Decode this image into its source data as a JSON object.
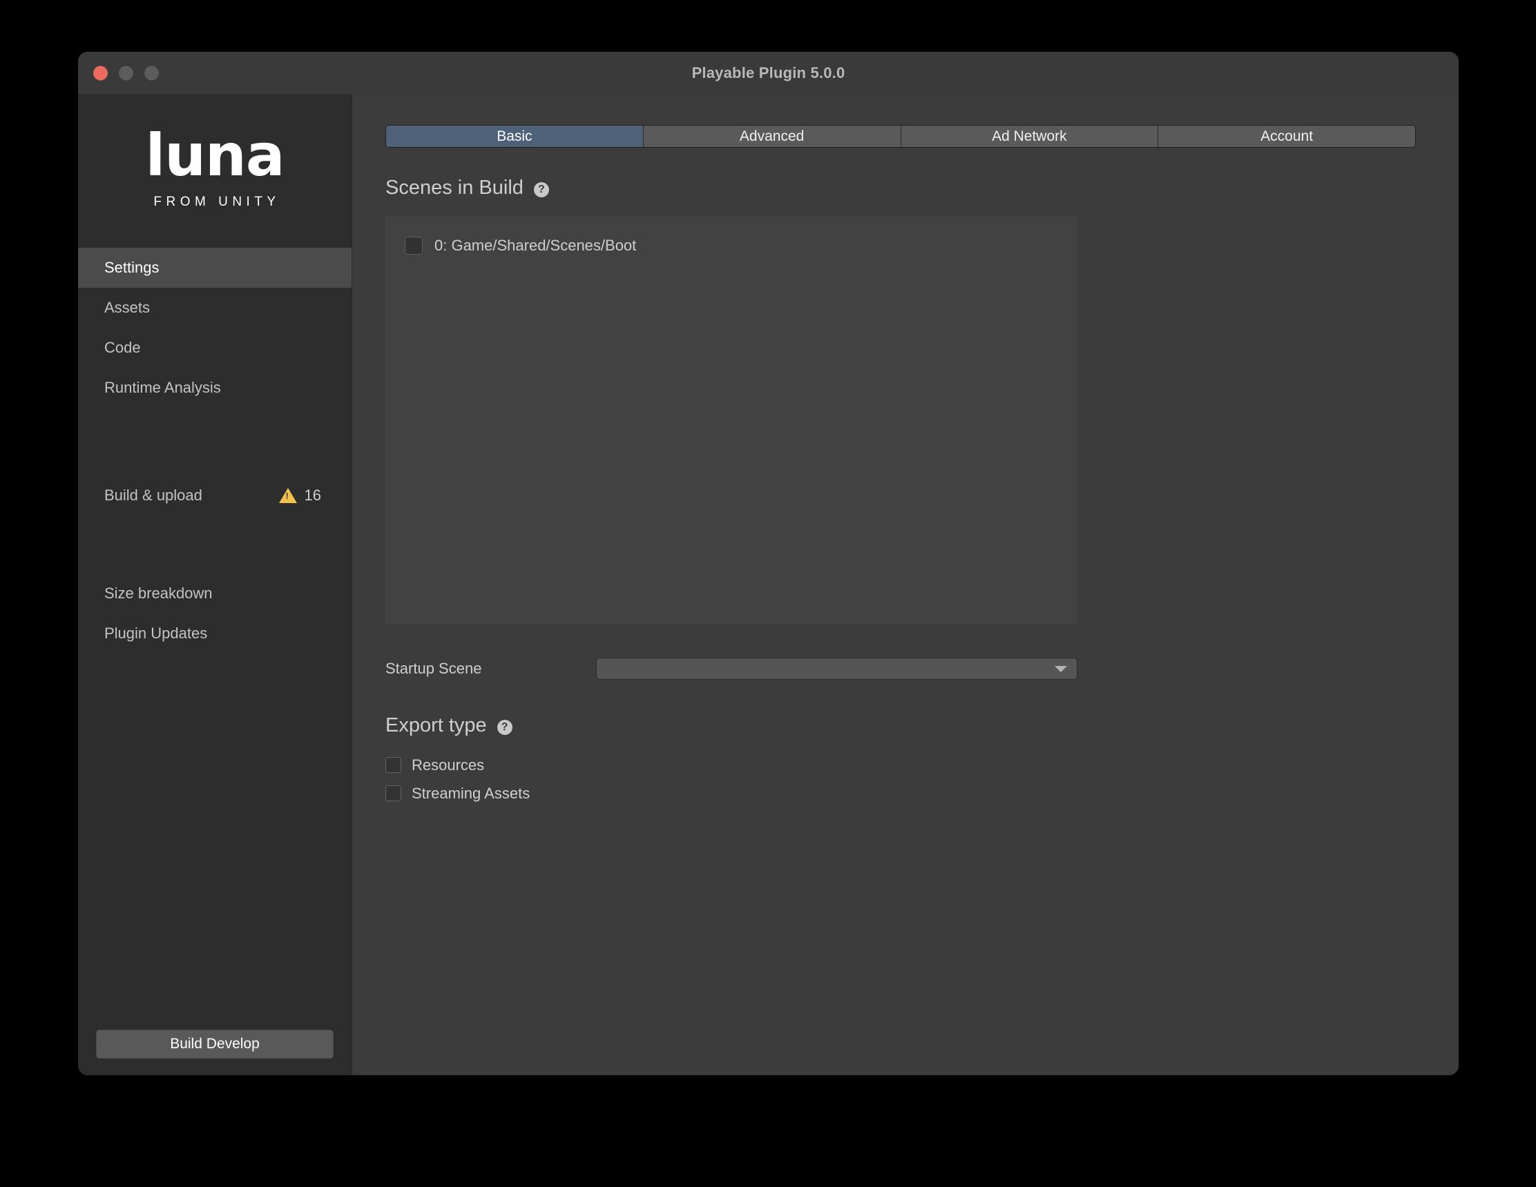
{
  "window": {
    "title": "Playable Plugin 5.0.0",
    "traffic_lights": [
      "close",
      "minimize",
      "maximize"
    ]
  },
  "sidebar": {
    "logo": {
      "wordmark": "Luna",
      "tagline": "FROM UNITY"
    },
    "items": [
      {
        "label": "Settings",
        "active": true
      },
      {
        "label": "Assets",
        "active": false
      },
      {
        "label": "Code",
        "active": false
      },
      {
        "label": "Runtime Analysis",
        "active": false
      }
    ],
    "build_upload": {
      "label": "Build & upload",
      "warning_count": "16",
      "warning_color": "#f2c14b"
    },
    "extra_items": [
      {
        "label": "Size breakdown"
      },
      {
        "label": "Plugin Updates"
      }
    ],
    "build_button_label": "Build Develop"
  },
  "main": {
    "tabs": [
      {
        "label": "Basic",
        "active": true
      },
      {
        "label": "Advanced",
        "active": false
      },
      {
        "label": "Ad Network",
        "active": false
      },
      {
        "label": "Account",
        "active": false
      }
    ],
    "active_tab_color": "#4e6179",
    "scenes": {
      "heading": "Scenes in Build",
      "help": "?",
      "list": [
        {
          "label": "0: Game/Shared/Scenes/Boot",
          "checked": false
        }
      ]
    },
    "startup_scene": {
      "label": "Startup Scene",
      "value": "",
      "placeholder": ""
    },
    "export_type": {
      "heading": "Export type",
      "help": "?",
      "options": [
        {
          "label": "Resources",
          "checked": false
        },
        {
          "label": "Streaming Assets",
          "checked": false
        }
      ]
    }
  }
}
